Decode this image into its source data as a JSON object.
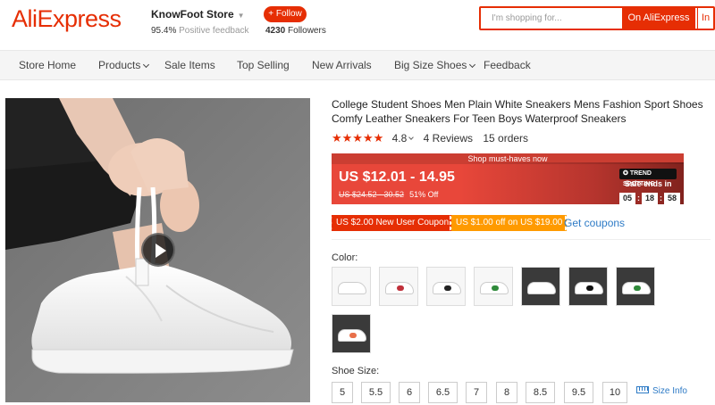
{
  "header": {
    "logo": "AliExpress",
    "store_name": "KnowFoot Store",
    "feedback_value": "95.4%",
    "feedback_label": "Positive feedback",
    "follow_label": "+ Follow",
    "followers_count": "4230",
    "followers_label": "Followers",
    "search_placeholder": "I'm shopping for...",
    "search_button": "On AliExpress",
    "search_button2": "In"
  },
  "nav": {
    "items": [
      "Store Home",
      "Products",
      "Sale Items",
      "Top Selling",
      "New Arrivals",
      "Big Size Shoes",
      "Feedback"
    ]
  },
  "product": {
    "title": "College Student Shoes Men Plain White Sneakers Mens Fashion Sport Shoes Comfy Leather Sneakers For Teen Boys Waterproof Sneakers",
    "stars": "★★★★★",
    "rating": "4.8",
    "reviews": "4 Reviews",
    "orders": "15 orders",
    "promo_header": "Shop must-haves now",
    "price": "US $12.01 - 14.95",
    "original_price": "US $24.52 - 30.52",
    "discount": "51% Off",
    "trend_label": "TREND SPOTTING",
    "sale_ends": "Sale ends in",
    "timer": [
      "05",
      "18",
      "58"
    ],
    "coupon_new_user": "US $2.00 New User Coupon",
    "coupon_store": "US $1.00 off on US $19.00",
    "get_coupons": "Get coupons",
    "color_label": "Color:",
    "size_label": "Shoe Size:",
    "sizes": [
      "5",
      "5.5",
      "6",
      "6.5",
      "7",
      "8",
      "8.5",
      "9.5",
      "10"
    ],
    "size_info": "Size Info"
  },
  "colors": {
    "brand": "#e62e04",
    "coupon_orange": "#ff9a00",
    "link": "#2e7bc6"
  }
}
